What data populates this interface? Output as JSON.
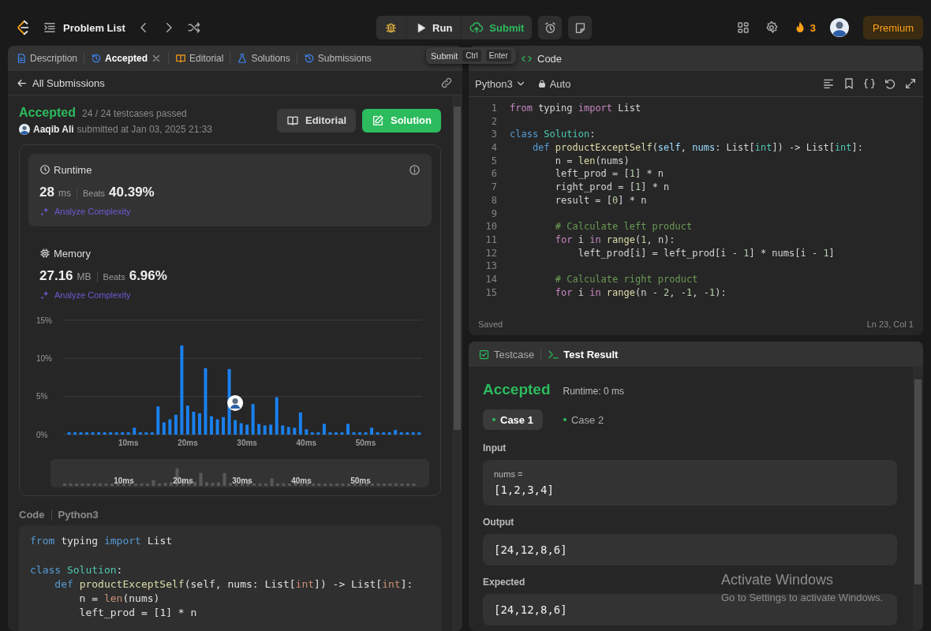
{
  "topbar": {
    "problem_list": "Problem List",
    "run": "Run",
    "submit": "Submit",
    "streak": "3",
    "premium": "Premium"
  },
  "tooltip": {
    "label": "Submit",
    "keys": [
      "Ctrl",
      "Enter"
    ]
  },
  "left_panel": {
    "tabs": [
      {
        "label": "Description",
        "kind": "description",
        "selected": false,
        "closable": false
      },
      {
        "label": "Accepted",
        "kind": "accepted",
        "selected": true,
        "closable": true
      },
      {
        "label": "Editorial",
        "kind": "editorial",
        "selected": false,
        "closable": false
      },
      {
        "label": "Solutions",
        "kind": "solutions",
        "selected": false,
        "closable": false
      },
      {
        "label": "Submissions",
        "kind": "submissions",
        "selected": false,
        "closable": false
      }
    ],
    "back_link": "All Submissions",
    "status": "Accepted",
    "testcases": "24 / 24 testcases passed",
    "user": "Aaqib Ali",
    "submitted": "submitted at Jan 03, 2025 21:33",
    "buttons": [
      {
        "label": "Editorial",
        "kind": "editorial"
      },
      {
        "label": "Solution",
        "kind": "solution"
      }
    ],
    "metrics": [
      {
        "kind": "runtime",
        "title": "Runtime",
        "value": "28",
        "unit": "ms",
        "beats_label": "Beats",
        "beats": "40.39%",
        "analyze": "Analyze Complexity",
        "selected": true,
        "info": true
      },
      {
        "kind": "memory",
        "title": "Memory",
        "value": "27.16",
        "unit": "MB",
        "beats_label": "Beats",
        "beats": "6.96%",
        "analyze": "Analyze Complexity",
        "selected": false,
        "info": false
      }
    ],
    "chart_data": {
      "type": "bar",
      "ylim": [
        0,
        15
      ],
      "xlim": [
        -1,
        59.5
      ],
      "yticks": [
        {
          "value": 0,
          "label": "0%"
        },
        {
          "value": 5,
          "label": "5%"
        },
        {
          "value": 10,
          "label": "10%"
        },
        {
          "value": 15,
          "label": "15%"
        }
      ],
      "xticks": [
        {
          "value": 10,
          "label": "10ms"
        },
        {
          "value": 20,
          "label": "20ms"
        },
        {
          "value": 30,
          "label": "30ms"
        },
        {
          "value": 40,
          "label": "40ms"
        },
        {
          "value": 50,
          "label": "50ms"
        }
      ],
      "x": [
        0,
        1,
        2,
        3,
        4,
        5,
        6,
        7,
        8,
        9,
        10,
        11,
        12,
        13,
        14,
        15,
        16,
        17,
        18,
        19,
        20,
        21,
        22,
        23,
        24,
        25,
        26,
        27,
        28,
        29,
        30,
        31,
        32,
        33,
        34,
        35,
        36,
        37,
        38,
        39,
        40,
        41,
        42,
        43,
        44,
        45,
        46,
        47,
        48,
        49,
        50,
        51,
        52,
        53,
        54,
        55,
        56,
        57,
        58,
        59
      ],
      "values": [
        0.3,
        0.3,
        0.3,
        0.3,
        0.3,
        0.3,
        0.3,
        0.3,
        0.3,
        0.3,
        0.3,
        0.9,
        0.3,
        0.3,
        0.3,
        3.7,
        1.6,
        2.0,
        2.6,
        11.7,
        3.8,
        3.0,
        2.8,
        8.7,
        2.4,
        2.0,
        2.3,
        8.6,
        1.9,
        1.5,
        1.3,
        4.0,
        1.4,
        1.2,
        1.3,
        4.9,
        1.2,
        1.0,
        0.9,
        2.9,
        0.7,
        0.3,
        0.3,
        1.4,
        0.3,
        0.3,
        0.3,
        1.4,
        0.3,
        0.3,
        0.3,
        0.9,
        0.3,
        0.3,
        0.3,
        0.6,
        0.3,
        0.3,
        0.3,
        0.3
      ]
    },
    "range_navigator": {
      "labels": [
        "10ms",
        "20ms",
        "30ms",
        "40ms",
        "50ms"
      ]
    },
    "code_label": "Code",
    "code_language": "Python3",
    "code": [
      {
        "kind": "code",
        "tokens": [
          {
            "kind": "ctl",
            "text": "from"
          },
          {
            "kind": "txt",
            "text": " typing "
          },
          {
            "kind": "ctl",
            "text": "import"
          },
          {
            "kind": "txt",
            "text": " List"
          }
        ]
      },
      {
        "kind": "blank"
      },
      {
        "kind": "code",
        "tokens": [
          {
            "kind": "kw",
            "text": "class "
          },
          {
            "kind": "cls",
            "text": "Solution"
          },
          {
            "kind": "txt",
            "text": ":"
          }
        ]
      },
      {
        "kind": "code",
        "tokens": [
          {
            "kind": "kw",
            "text": "    def "
          },
          {
            "kind": "fn",
            "text": "productExceptSelf"
          },
          {
            "kind": "txt",
            "text": "("
          },
          {
            "kind": "param",
            "text": "self"
          },
          {
            "kind": "txt",
            "text": ", "
          },
          {
            "kind": "param",
            "text": "nums"
          },
          {
            "kind": "txt",
            "text": ": List["
          },
          {
            "kind": "type",
            "text": "int"
          },
          {
            "kind": "txt",
            "text": "]) -> List["
          },
          {
            "kind": "type",
            "text": "int"
          },
          {
            "kind": "txt",
            "text": "]:"
          }
        ]
      },
      {
        "kind": "code",
        "tokens": [
          {
            "kind": "txt",
            "text": "        n = "
          },
          {
            "kind": "bi",
            "text": "len"
          },
          {
            "kind": "txt",
            "text": "(nums)"
          }
        ]
      },
      {
        "kind": "code",
        "tokens": [
          {
            "kind": "txt",
            "text": "        left_prod = ["
          },
          {
            "kind": "num",
            "text": "1"
          },
          {
            "kind": "txt",
            "text": "] * n"
          }
        ]
      }
    ]
  },
  "editor": {
    "title": "Code",
    "language": "Python3",
    "mode": "Auto",
    "status": "Saved",
    "cursor": "Ln 23, Col 1",
    "lines": [
      {
        "number": "1",
        "kind": "code",
        "tokens": [
          {
            "kind": "ctl",
            "text": "from"
          },
          {
            "kind": "txt",
            "text": " typing "
          },
          {
            "kind": "ctl",
            "text": "import"
          },
          {
            "kind": "txt",
            "text": " List"
          }
        ]
      },
      {
        "number": "2",
        "kind": "blank"
      },
      {
        "number": "3",
        "kind": "code",
        "tokens": [
          {
            "kind": "kw",
            "text": "class "
          },
          {
            "kind": "cls",
            "text": "Solution"
          },
          {
            "kind": "txt",
            "text": ":"
          }
        ]
      },
      {
        "number": "4",
        "kind": "code",
        "tokens": [
          {
            "kind": "kw",
            "text": "    def "
          },
          {
            "kind": "fn",
            "text": "productExceptSelf"
          },
          {
            "kind": "txt",
            "text": "("
          },
          {
            "kind": "param",
            "text": "self"
          },
          {
            "kind": "txt",
            "text": ", "
          },
          {
            "kind": "param",
            "text": "nums"
          },
          {
            "kind": "txt",
            "text": ": List["
          },
          {
            "kind": "type",
            "text": "int"
          },
          {
            "kind": "txt",
            "text": "]) -> List["
          },
          {
            "kind": "type",
            "text": "int"
          },
          {
            "kind": "txt",
            "text": "]:"
          }
        ]
      },
      {
        "number": "5",
        "kind": "code",
        "tokens": [
          {
            "kind": "txt",
            "text": "        n = "
          },
          {
            "kind": "bi",
            "text": "len"
          },
          {
            "kind": "txt",
            "text": "(nums)"
          }
        ]
      },
      {
        "number": "6",
        "kind": "code",
        "tokens": [
          {
            "kind": "txt",
            "text": "        left_prod = ["
          },
          {
            "kind": "num",
            "text": "1"
          },
          {
            "kind": "txt",
            "text": "] * n"
          }
        ]
      },
      {
        "number": "7",
        "kind": "code",
        "tokens": [
          {
            "kind": "txt",
            "text": "        right_prod = ["
          },
          {
            "kind": "num",
            "text": "1"
          },
          {
            "kind": "txt",
            "text": "] * n"
          }
        ]
      },
      {
        "number": "8",
        "kind": "code",
        "tokens": [
          {
            "kind": "txt",
            "text": "        result = ["
          },
          {
            "kind": "num",
            "text": "0"
          },
          {
            "kind": "txt",
            "text": "] * n"
          }
        ]
      },
      {
        "number": "9",
        "kind": "blank"
      },
      {
        "number": "10",
        "kind": "code",
        "tokens": [
          {
            "kind": "cm",
            "text": "        # Calculate left product"
          }
        ]
      },
      {
        "number": "11",
        "kind": "code",
        "tokens": [
          {
            "kind": "ctl",
            "text": "        for"
          },
          {
            "kind": "txt",
            "text": " i "
          },
          {
            "kind": "ctl",
            "text": "in"
          },
          {
            "kind": "bi",
            "text": " range"
          },
          {
            "kind": "txt",
            "text": "("
          },
          {
            "kind": "num",
            "text": "1"
          },
          {
            "kind": "txt",
            "text": ", n):"
          }
        ]
      },
      {
        "number": "12",
        "kind": "code",
        "tokens": [
          {
            "kind": "txt",
            "text": "            left_prod[i] = left_prod[i - "
          },
          {
            "kind": "num",
            "text": "1"
          },
          {
            "kind": "txt",
            "text": "] * nums[i - "
          },
          {
            "kind": "num",
            "text": "1"
          },
          {
            "kind": "txt",
            "text": "]"
          }
        ]
      },
      {
        "number": "13",
        "kind": "blank"
      },
      {
        "number": "14",
        "kind": "code",
        "tokens": [
          {
            "kind": "cm",
            "text": "        # Calculate right product"
          }
        ]
      },
      {
        "number": "15",
        "kind": "code",
        "tokens": [
          {
            "kind": "ctl",
            "text": "        for"
          },
          {
            "kind": "txt",
            "text": " i "
          },
          {
            "kind": "ctl",
            "text": "in"
          },
          {
            "kind": "bi",
            "text": " range"
          },
          {
            "kind": "txt",
            "text": "(n - "
          },
          {
            "kind": "num",
            "text": "2"
          },
          {
            "kind": "txt",
            "text": ", -"
          },
          {
            "kind": "num",
            "text": "1"
          },
          {
            "kind": "txt",
            "text": ", -"
          },
          {
            "kind": "num",
            "text": "1"
          },
          {
            "kind": "txt",
            "text": "):"
          }
        ]
      }
    ]
  },
  "result": {
    "tabs": [
      {
        "label": "Testcase",
        "kind": "testcase",
        "selected": false
      },
      {
        "label": "Test Result",
        "kind": "result",
        "selected": true
      }
    ],
    "status": "Accepted",
    "runtime": "Runtime: 0 ms",
    "cases": [
      {
        "label": "Case 1",
        "selected": true,
        "passed": true
      },
      {
        "label": "Case 2",
        "selected": false,
        "passed": true
      }
    ],
    "sections": [
      {
        "label": "Input",
        "variable": "nums =",
        "value": "[1,2,3,4]"
      },
      {
        "label": "Output",
        "value": "[24,12,8,6]"
      },
      {
        "label": "Expected",
        "value": "[24,12,8,6]"
      }
    ]
  },
  "os_notice": {
    "title": "Activate Windows",
    "text": "Go to Settings to activate Windows."
  }
}
